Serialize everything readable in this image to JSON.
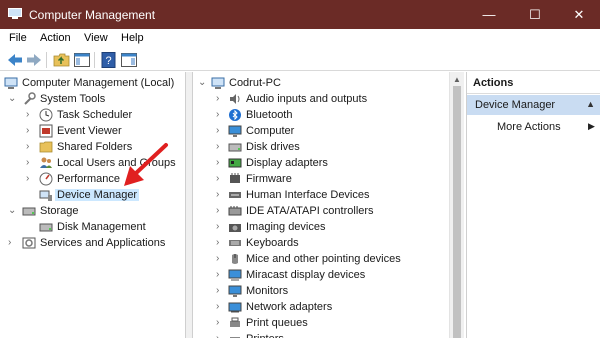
{
  "window": {
    "title": "Computer Management",
    "min": "—",
    "max": "☐",
    "close": "✕"
  },
  "menu": [
    "File",
    "Action",
    "View",
    "Help"
  ],
  "left_tree": {
    "root": "Computer Management (Local)",
    "system_tools": "System Tools",
    "task_scheduler": "Task Scheduler",
    "event_viewer": "Event Viewer",
    "shared_folders": "Shared Folders",
    "local_users": "Local Users and Groups",
    "performance": "Performance",
    "device_manager": "Device Manager",
    "storage": "Storage",
    "disk_management": "Disk Management",
    "services": "Services and Applications"
  },
  "devices": {
    "computer_name": "Codrut-PC",
    "items": [
      "Audio inputs and outputs",
      "Bluetooth",
      "Computer",
      "Disk drives",
      "Display adapters",
      "Firmware",
      "Human Interface Devices",
      "IDE ATA/ATAPI controllers",
      "Imaging devices",
      "Keyboards",
      "Mice and other pointing devices",
      "Miracast display devices",
      "Monitors",
      "Network adapters",
      "Print queues",
      "Printers"
    ]
  },
  "actions": {
    "header": "Actions",
    "section": "Device Manager",
    "more": "More Actions"
  },
  "colors": {
    "titlebar": "#6b2b26",
    "selection": "#cce8ff",
    "actions_section": "#c9dcf2",
    "annotation": "#e02020"
  }
}
